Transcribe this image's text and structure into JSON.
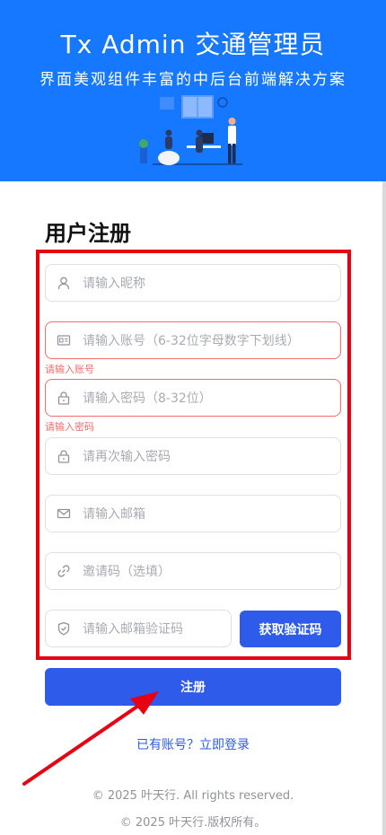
{
  "header": {
    "title": "Tx Admin  交通管理员",
    "subtitle": "界面美观组件丰富的中后台前端解决方案"
  },
  "form": {
    "title": "用户注册",
    "nickname_placeholder": "请输入昵称",
    "account_placeholder": "请输入账号（6-32位字母数字下划线）",
    "account_error": "请输入账号",
    "password_placeholder": "请输入密码（8-32位）",
    "password_error": "请输入密码",
    "confirm_placeholder": "请再次输入密码",
    "email_placeholder": "请输入邮箱",
    "invite_placeholder": "邀请码（选填）",
    "code_placeholder": "请输入邮箱验证码",
    "get_code_label": "获取验证码",
    "submit_label": "注册",
    "login_link": "已有账号？立即登录"
  },
  "footer": {
    "line1": "© 2025 叶天行. All rights reserved.",
    "line2": "© 2025 叶天行.版权所有。"
  },
  "icons": {
    "nickname": "user-icon",
    "account": "id-card-icon",
    "password": "lock-icon",
    "confirm": "lock-icon",
    "email": "mail-icon",
    "invite": "link-icon",
    "code": "shield-check-icon"
  },
  "colors": {
    "header_bg": "#1677ff",
    "primary": "#2e5bea",
    "error": "#f56c6c",
    "highlight": "#e60012"
  }
}
